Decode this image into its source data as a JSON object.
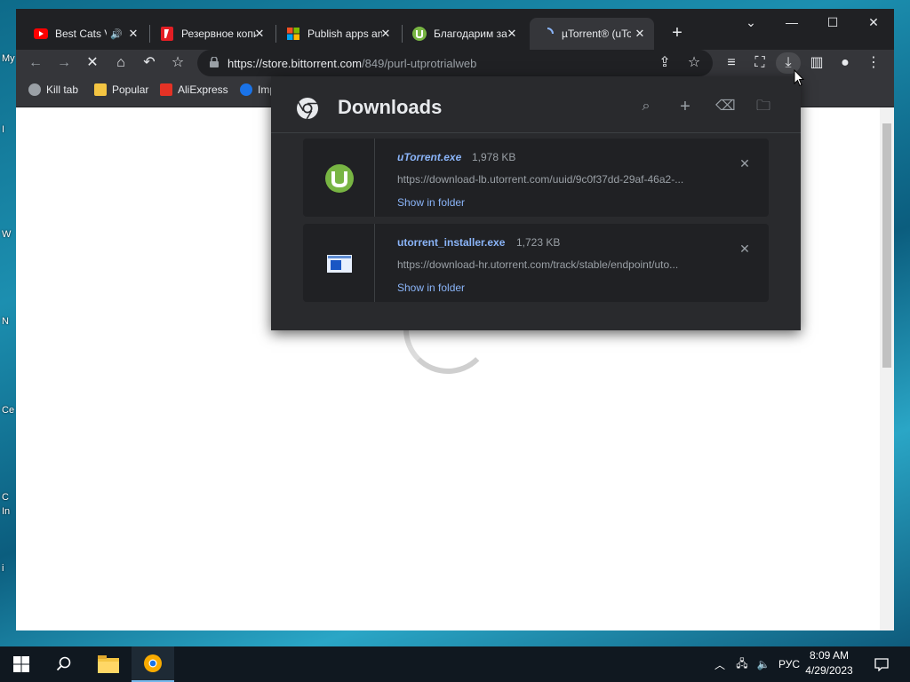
{
  "desktop": {
    "fragments": [
      "My",
      "I",
      "W",
      "N",
      "Ce",
      "C",
      "In",
      "i"
    ]
  },
  "tabs": [
    {
      "title": "Best Cats Videos",
      "icon": "youtube-icon",
      "audio": true
    },
    {
      "title": "Резервное копирование",
      "icon": "yandex-disk-icon"
    },
    {
      "title": "Publish apps and games",
      "icon": "microsoft-icon"
    },
    {
      "title": "Благодарим за загрузку",
      "icon": "utorrent-icon"
    },
    {
      "title": "µTorrent® (uTorrent)",
      "icon": "loading-icon",
      "active": true
    }
  ],
  "toolbar": {
    "url_host": "https://store.bittorrent.com",
    "url_path": "/849/purl-utprotrialweb"
  },
  "bookmarks": [
    {
      "label": "Kill tab",
      "icon": "globe-icon"
    },
    {
      "label": "Popular",
      "icon": "folder-icon"
    },
    {
      "label": "AliExpress",
      "icon": "aliexpress-icon"
    },
    {
      "label": "Imp",
      "icon": "gear-icon"
    }
  ],
  "downloads": {
    "title": "Downloads",
    "items": [
      {
        "filename": "uTorrent.exe",
        "size": "1,978 KB",
        "url": "https://download-lb.utorrent.com/uuid/9c0f37dd-29af-46a2-...",
        "action": "Show in folder",
        "icon": "utorrent-icon"
      },
      {
        "filename": "utorrent_installer.exe",
        "size": "1,723 KB",
        "url": "https://download-hr.utorrent.com/track/stable/endpoint/uto...",
        "action": "Show in folder",
        "icon": "installer-icon"
      }
    ]
  },
  "taskbar": {
    "language": "РУС",
    "time": "8:09 AM",
    "date": "4/29/2023"
  },
  "colors": {
    "accent_link": "#8ab4f8",
    "panel_bg": "#292a2d",
    "utorrent_green": "#78b543"
  }
}
